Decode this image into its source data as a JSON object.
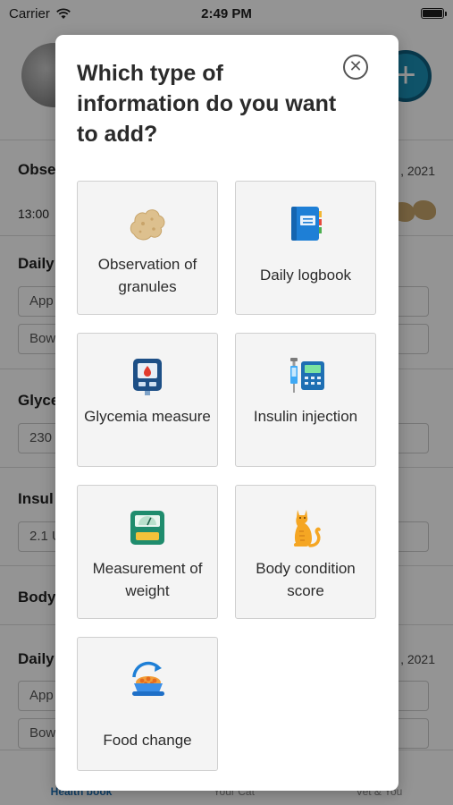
{
  "status_bar": {
    "carrier": "Carrier",
    "time": "2:49 PM"
  },
  "background": {
    "add_button": "+",
    "sections": [
      {
        "title": "Obse",
        "date": ", 2021",
        "time": "13:00"
      },
      {
        "title": "Daily",
        "fields": [
          "App",
          "Bow"
        ]
      },
      {
        "title": "Glyce",
        "fields": [
          "230"
        ]
      },
      {
        "title": "Insul",
        "fields": [
          "2.1 U"
        ]
      },
      {
        "title": "Body"
      },
      {
        "title": "Daily",
        "date": ", 2021",
        "fields": [
          "App",
          "Bow"
        ]
      }
    ],
    "tabs": [
      "Health book",
      "Your Cat",
      "Vet & You"
    ]
  },
  "modal": {
    "title": "Which type of information do you want to add?",
    "close_label": "✕",
    "options": [
      {
        "label": "Observation of granules",
        "icon": "granule-icon"
      },
      {
        "label": "Daily logbook",
        "icon": "logbook-icon"
      },
      {
        "label": "Glycemia measure",
        "icon": "glucometer-icon"
      },
      {
        "label": "Insulin injection",
        "icon": "insulin-syringe-icon"
      },
      {
        "label": "Measurement of weight",
        "icon": "scale-icon"
      },
      {
        "label": "Body condition score",
        "icon": "cat-icon"
      },
      {
        "label": "Food change",
        "icon": "food-bowl-icon"
      }
    ]
  },
  "colors": {
    "accent": "#1a8fb5",
    "tile_bg": "#f4f4f4",
    "overlay": "rgba(0,0,0,0.42)"
  }
}
